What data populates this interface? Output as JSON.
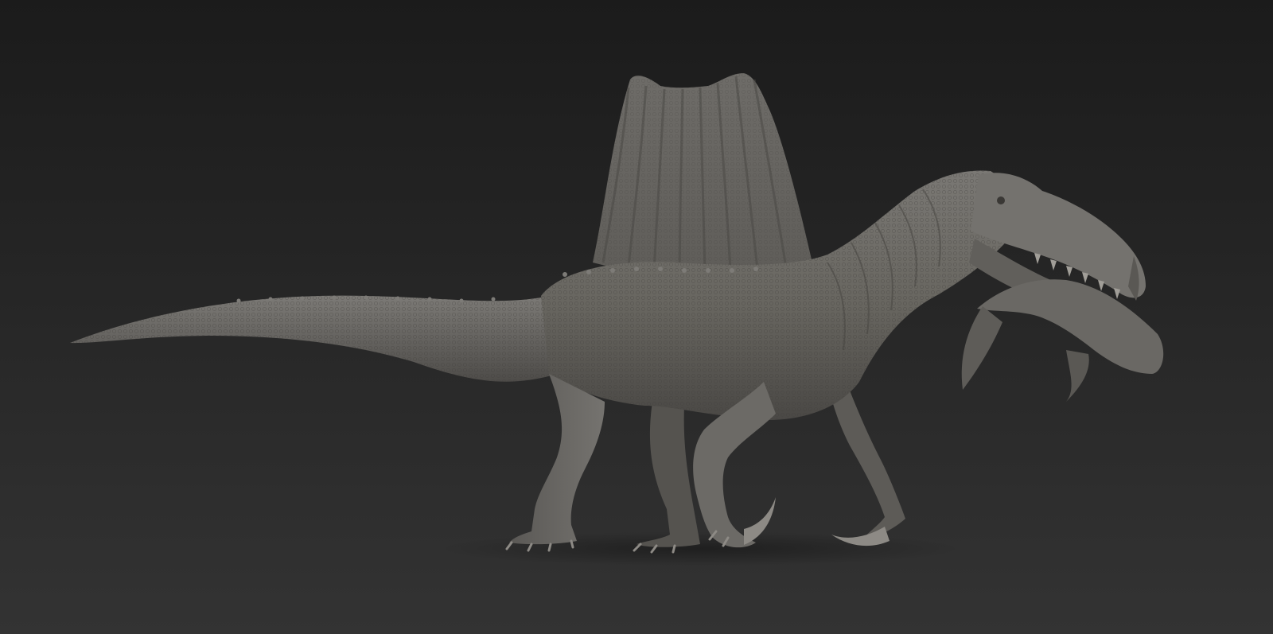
{
  "scene": {
    "subject": "spinosaurus-sculpt-with-fish",
    "background": {
      "top": "#1b1b1b",
      "bottom": "#333333"
    },
    "material": {
      "base": "#6b6966",
      "mid": "#5a5855",
      "light": "#85837f",
      "dark": "#3c3a38",
      "claw": "#8d8a85"
    }
  }
}
